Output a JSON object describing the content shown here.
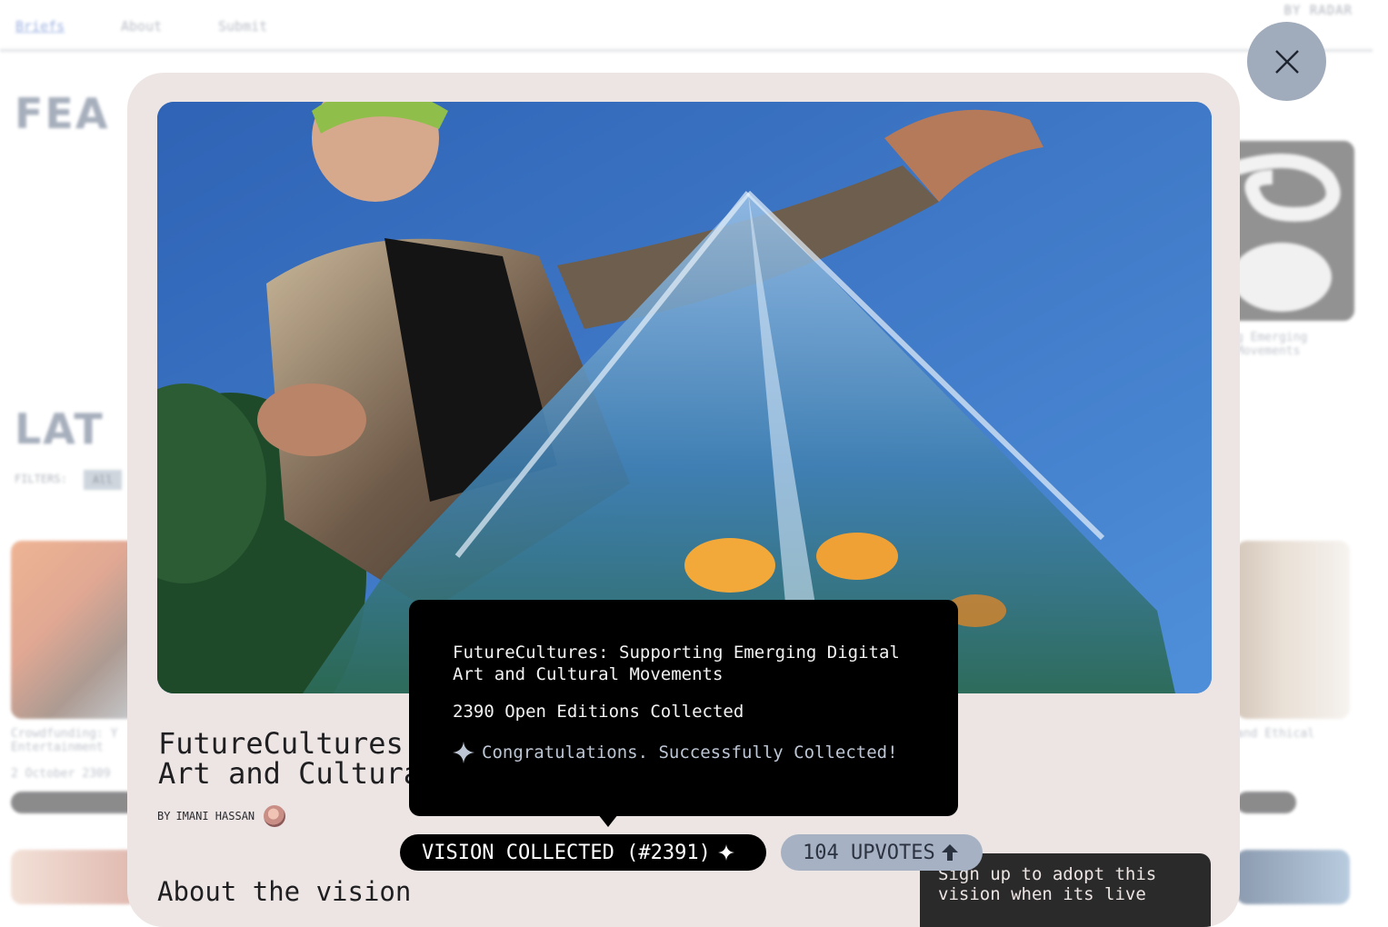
{
  "nav": {
    "links": [
      "Briefs",
      "About",
      "Submit"
    ],
    "brand": "BY RADAR"
  },
  "background": {
    "featured_heading": "FEA",
    "latest_heading": "LAT",
    "filters_label": "FILTERS:",
    "filter_all": "All",
    "card_text_left": "Crowdfunding: Y Entertainment",
    "card_date_left": "2 October 2309",
    "card_text_right_top_1": "g Emerging",
    "card_text_right_top_2": "Movements",
    "card_text_right_bottom": "and Ethical"
  },
  "modal": {
    "title_line1": "FutureCultures:",
    "title_line2": "Art and Cultura",
    "byline_prefix": "BY",
    "author": "IMANI HASSAN",
    "about_heading": "About the vision",
    "signup_text": "Sign up to adopt this vision when its live"
  },
  "actions": {
    "collected_label": "VISION COLLECTED (#2391)",
    "upvotes_label": "104 UPVOTES"
  },
  "tooltip": {
    "title": "FutureCultures: Supporting Emerging Digital Art and Cultural Movements",
    "count": "2390 Open Editions Collected",
    "success": "Congratulations. Successfully Collected!"
  },
  "icons": {
    "close": "close-icon",
    "sparkle": "sparkle-icon",
    "upvote": "upvote-arrow-icon"
  },
  "colors": {
    "modal_bg": "#ece5e3",
    "close_btn": "#a0abbb",
    "upvote_pill": "#a6b2c4",
    "tooltip_bg": "#000000"
  }
}
